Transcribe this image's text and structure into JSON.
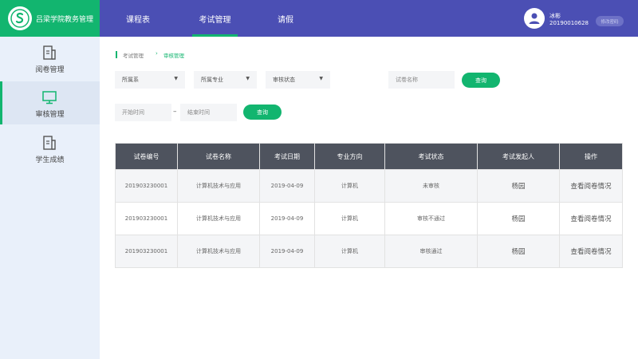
{
  "brand": {
    "name": "吕梁学院教务管理",
    "logo_icon": "school-logo-icon"
  },
  "top_nav": [
    {
      "label": "课程表",
      "active": false
    },
    {
      "label": "考试管理",
      "active": true
    },
    {
      "label": "请假",
      "active": false
    }
  ],
  "user": {
    "name": "冰彬",
    "id": "20190010628",
    "change_password": "修改密码",
    "avatar_icon": "user-avatar-icon"
  },
  "sidebar": {
    "items": [
      {
        "label": "阅卷管理",
        "icon": "document-icon",
        "active": false
      },
      {
        "label": "审核管理",
        "icon": "monitor-icon",
        "active": true
      },
      {
        "label": "学生成绩",
        "icon": "document-icon",
        "active": false
      }
    ]
  },
  "breadcrumb": {
    "parent": "考试管理",
    "separator": "›",
    "current": "审核管理"
  },
  "filters": {
    "department": "所属系",
    "major": "所属专业",
    "review_status": "审核状态",
    "paper_name_placeholder": "试卷名称",
    "query": "查询",
    "start_time_placeholder": "开始时间",
    "range_separator": "–",
    "end_time_placeholder": "结束时间",
    "query2": "查询"
  },
  "table": {
    "headers": [
      "试卷编号",
      "试卷名称",
      "考试日期",
      "专业方向",
      "考试状态",
      "考试发起人",
      "操作"
    ],
    "rows": [
      [
        "201903230001",
        "计算机技术与应用",
        "2019-04-09",
        "计算机",
        "未审核",
        "杨园",
        "查看阅卷情况"
      ],
      [
        "201903230001",
        "计算机技术与应用",
        "2019-04-09",
        "计算机",
        "审核不通过",
        "杨园",
        "查看阅卷情况"
      ],
      [
        "201903230001",
        "计算机技术与应用",
        "2019-04-09",
        "计算机",
        "审核通过",
        "杨园",
        "查看阅卷情况"
      ]
    ]
  },
  "colors": {
    "accent": "#12b56f",
    "header": "#4b4fb4",
    "sidebar": "#e9f0fa",
    "table_header": "#4e535e"
  }
}
